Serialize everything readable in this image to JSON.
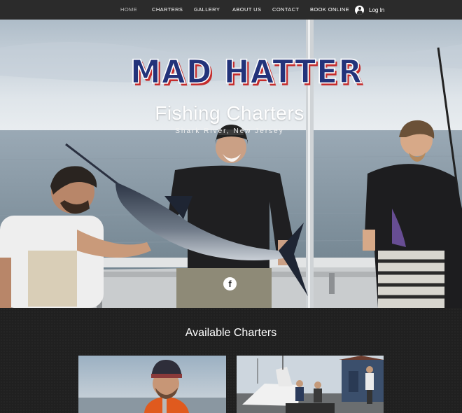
{
  "nav": {
    "items": [
      {
        "label": "HOME",
        "active": true
      },
      {
        "label": "CHARTERS",
        "active": false
      },
      {
        "label": "GALLERY",
        "active": false
      },
      {
        "label": "ABOUT US",
        "active": false
      },
      {
        "label": "CONTACT",
        "active": false
      },
      {
        "label": "BOOK ONLINE",
        "active": false
      }
    ],
    "login": {
      "label": "Log In",
      "icon": "user-avatar-icon"
    }
  },
  "hero": {
    "logo_text": "MAD HATTER",
    "title": "Fishing Charters",
    "subtitle": "Shark River, New Jersey",
    "social": {
      "icon": "facebook-icon",
      "glyph": "f"
    }
  },
  "charters": {
    "title": "Available Charters"
  },
  "colors": {
    "nav_bg": "#2b2b2b",
    "logo_blue": "#23337a",
    "logo_red": "#c42c2c",
    "section_bg": "#202020"
  }
}
